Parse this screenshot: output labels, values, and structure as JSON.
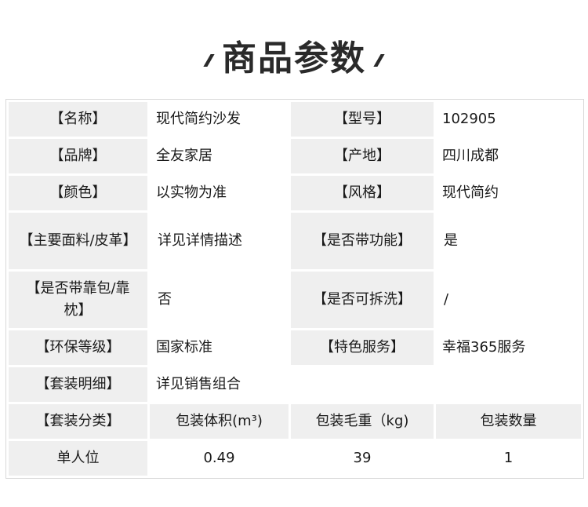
{
  "title": "商品参数",
  "rows": [
    {
      "k1": "【名称】",
      "v1": "现代简约沙发",
      "k2": "【型号】",
      "v2": "102905"
    },
    {
      "k1": "【品牌】",
      "v1": "全友家居",
      "k2": "【产地】",
      "v2": "四川成都"
    },
    {
      "k1": "【颜色】",
      "v1": "以实物为准",
      "k2": "【风格】",
      "v2": "现代简约"
    },
    {
      "k1": "【主要面料/皮革】",
      "v1": "详见详情描述",
      "k2": "【是否带功能】",
      "v2": "是"
    },
    {
      "k1": "【是否带靠包/靠枕】",
      "v1": "否",
      "k2": "【是否可拆洗】",
      "v2": "/"
    },
    {
      "k1": "【环保等级】",
      "v1": "国家标准",
      "k2": "【特色服务】",
      "v2": "幸福365服务"
    }
  ],
  "set_detail": {
    "k": "【套装明细】",
    "v": "详见销售组合"
  },
  "package_header": [
    "【套装分类】",
    "包装体积(m³)",
    "包装毛重（kg)",
    "包装数量"
  ],
  "package_row": [
    "单人位",
    "0.49",
    "39",
    "1"
  ]
}
